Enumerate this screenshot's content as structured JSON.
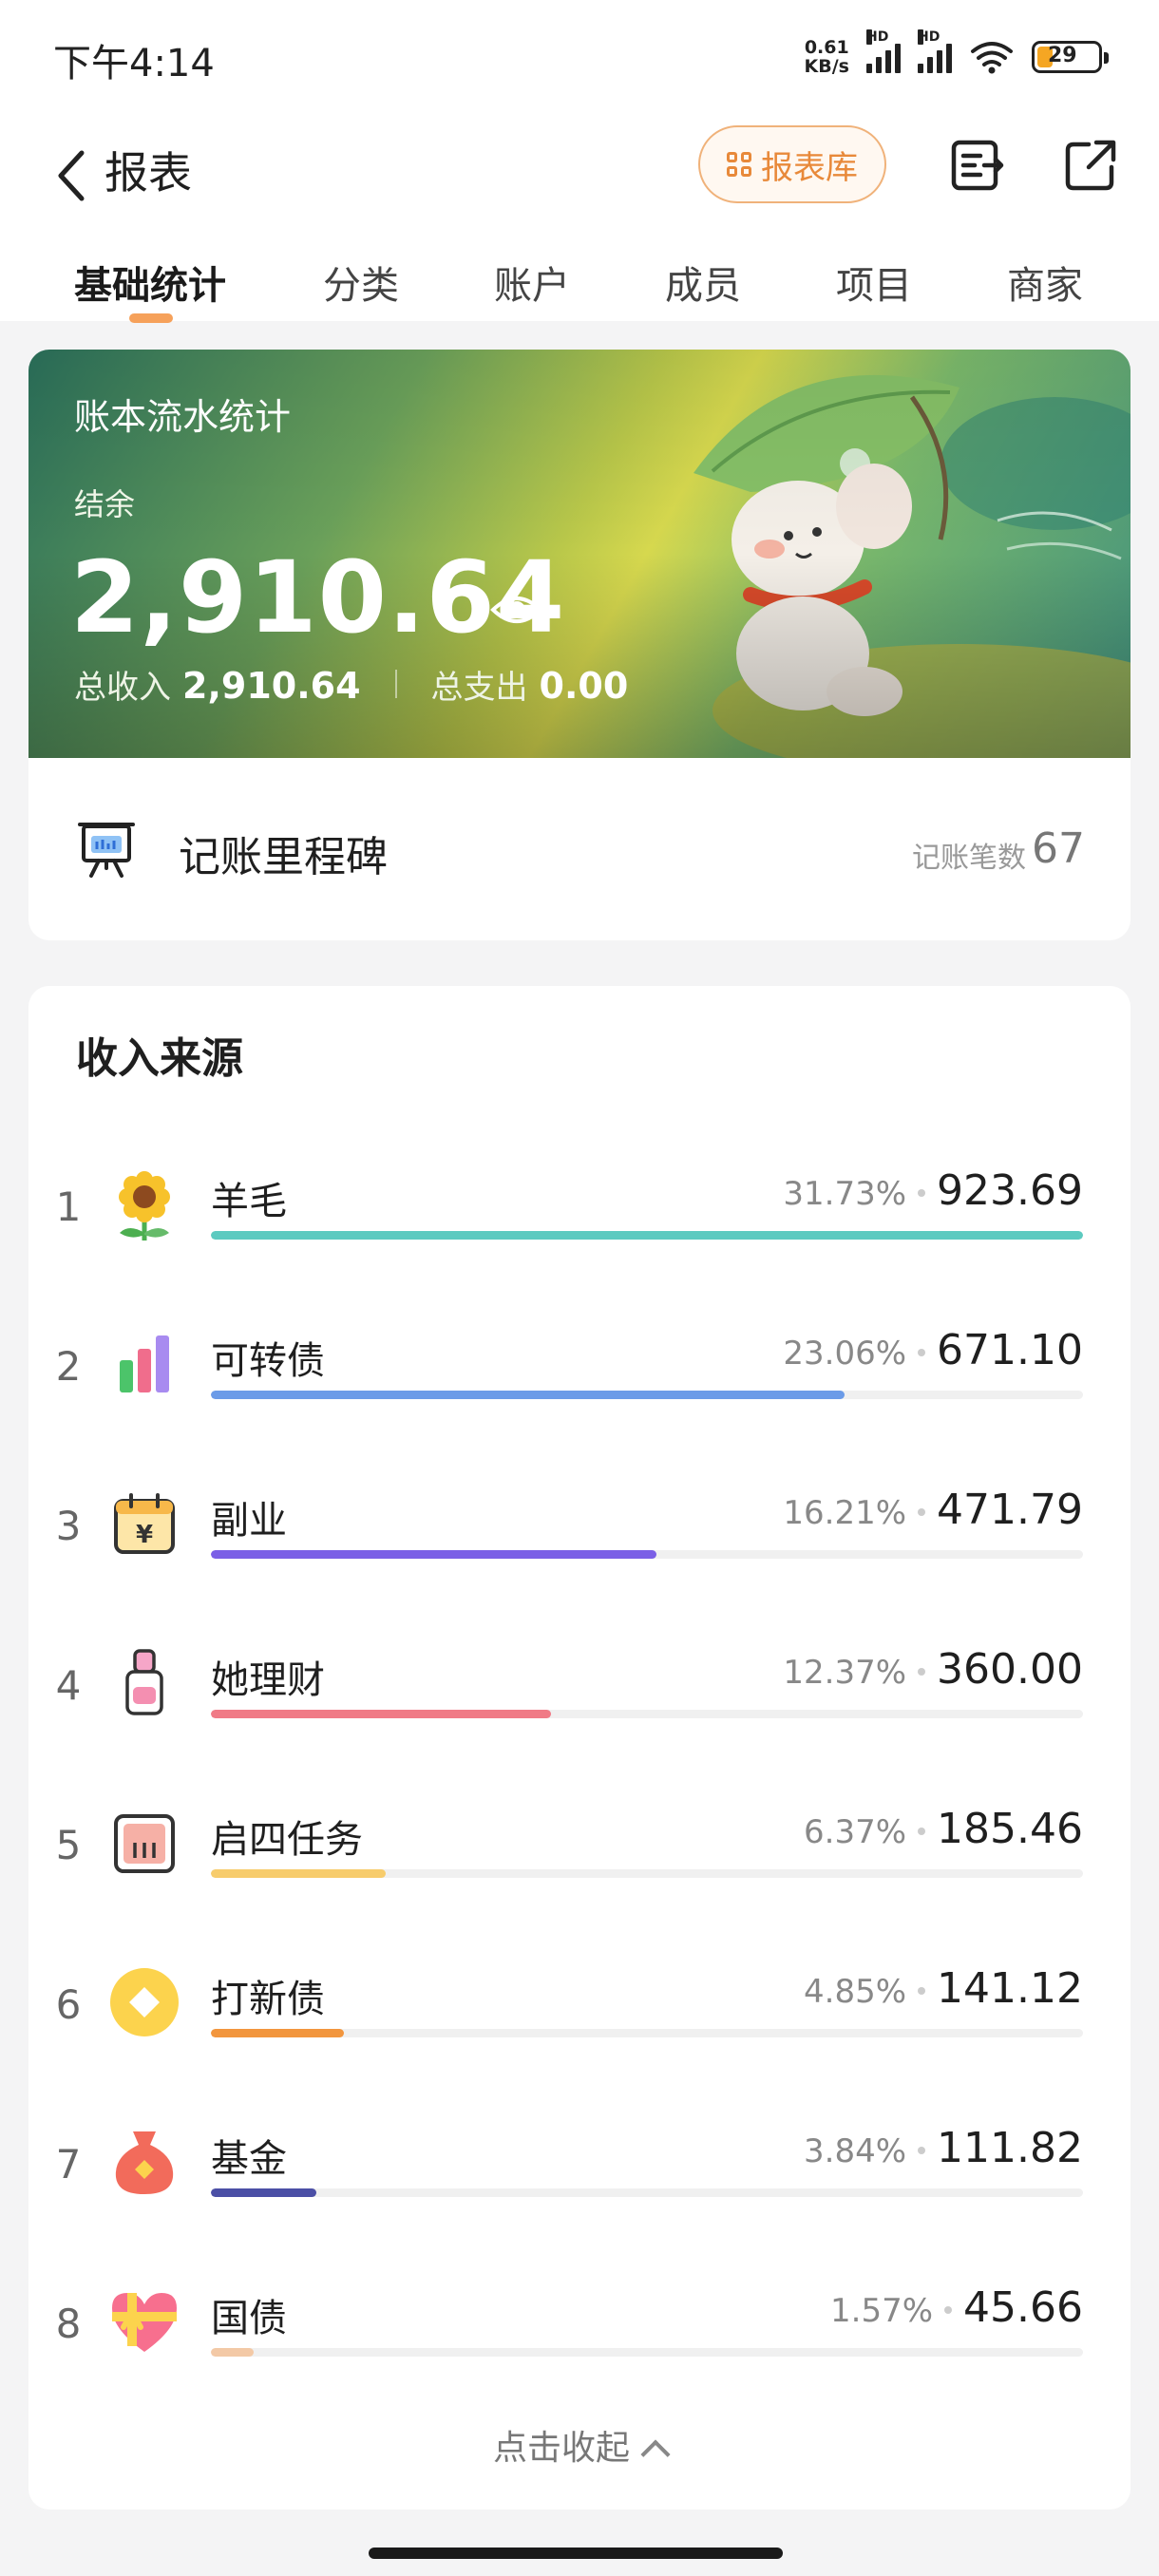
{
  "status_bar": {
    "time": "下午4:14",
    "net_speed_value": "0.61",
    "net_speed_unit": "KB/s",
    "hd1": "HD",
    "hd2": "HD",
    "battery": "29"
  },
  "header": {
    "title": "报表",
    "library_button": "报表库"
  },
  "tabs": [
    "基础统计",
    "分类",
    "账户",
    "成员",
    "项目",
    "商家"
  ],
  "active_tab": 0,
  "banner": {
    "title": "账本流水统计",
    "balance_label": "结余",
    "balance_value": "2,910.64",
    "income_label": "总收入",
    "income_value": "2,910.64",
    "expense_label": "总支出",
    "expense_value": "0.00"
  },
  "milestone": {
    "label": "记账里程碑",
    "count_label": "记账笔数",
    "count": "67"
  },
  "income_section": {
    "title": "收入来源",
    "items": [
      {
        "rank": "1",
        "name": "羊毛",
        "percent": "31.73%",
        "amount": "923.69",
        "share": 1.0,
        "color": "#5ccac0",
        "icon": "sunflower-icon"
      },
      {
        "rank": "2",
        "name": "可转债",
        "percent": "23.06%",
        "amount": "671.10",
        "share": 0.7266,
        "color": "#6b9be8",
        "icon": "bar-chart-icon"
      },
      {
        "rank": "3",
        "name": "副业",
        "percent": "16.21%",
        "amount": "471.79",
        "share": 0.5108,
        "color": "#7b5fe6",
        "icon": "yen-calendar-icon"
      },
      {
        "rank": "4",
        "name": "她理财",
        "percent": "12.37%",
        "amount": "360.00",
        "share": 0.3897,
        "color": "#f07a86",
        "icon": "lipstick-icon"
      },
      {
        "rank": "5",
        "name": "启四任务",
        "percent": "6.37%",
        "amount": "185.46",
        "share": 0.2008,
        "color": "#f7cc6c",
        "icon": "task-box-icon"
      },
      {
        "rank": "6",
        "name": "打新债",
        "percent": "4.85%",
        "amount": "141.12",
        "share": 0.1528,
        "color": "#f2963e",
        "icon": "coin-icon"
      },
      {
        "rank": "7",
        "name": "基金",
        "percent": "3.84%",
        "amount": "111.82",
        "share": 0.1211,
        "color": "#4b4fa6",
        "icon": "money-bag-icon"
      },
      {
        "rank": "8",
        "name": "国债",
        "percent": "1.57%",
        "amount": "45.66",
        "share": 0.0494,
        "color": "#f3c9a6",
        "icon": "gift-heart-icon"
      }
    ],
    "collapse_label": "点击收起"
  }
}
